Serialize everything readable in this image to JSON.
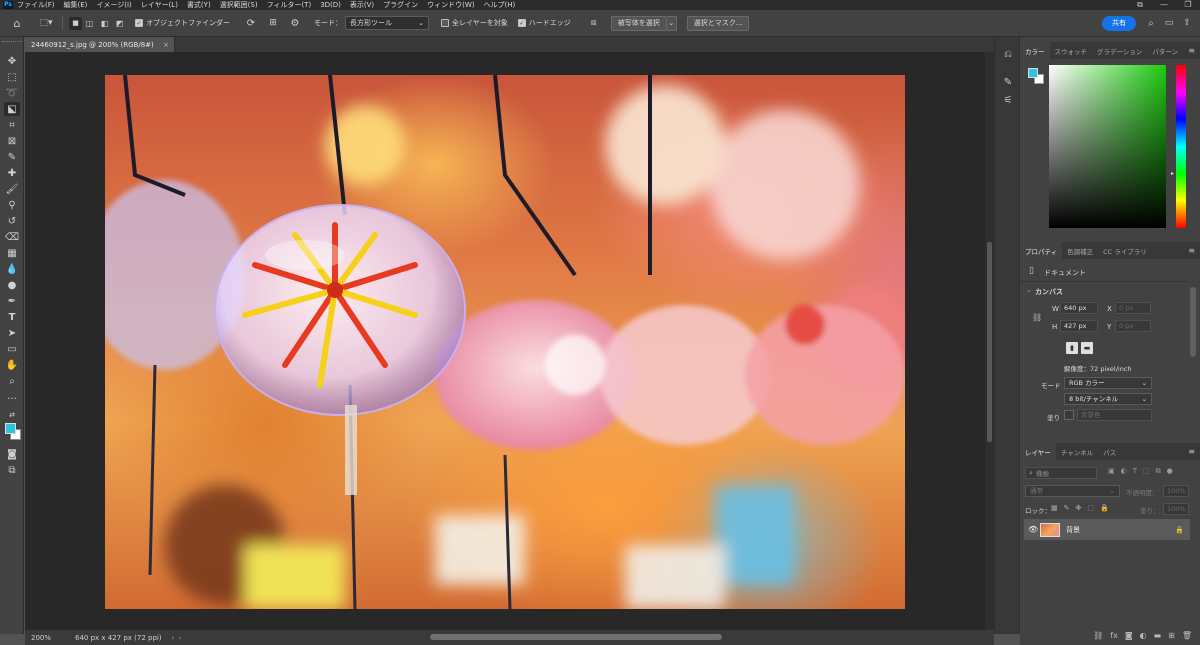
{
  "menubar": {
    "app_badge": "Ps",
    "items": [
      "ファイル(F)",
      "編集(E)",
      "イメージ(I)",
      "レイヤー(L)",
      "書式(Y)",
      "選択範囲(S)",
      "フィルター(T)",
      "3D(D)",
      "表示(V)",
      "プラグイン",
      "ウィンドウ(W)",
      "ヘルプ(H)"
    ],
    "window_controls": [
      "⧉",
      "—",
      "❐"
    ]
  },
  "options": {
    "object_finder_label": "オブジェクトファインダー",
    "mode_label": "モード：",
    "mode_value": "長方形ツール",
    "all_layers_label": "全レイヤーを対象",
    "hard_edge_label": "ハードエッジ",
    "select_subject_label": "被写体を選択",
    "select_mask_label": "選択とマスク...",
    "share_label": "共有"
  },
  "document": {
    "tab_title": "24460912_s.jpg @ 200% (RGB/8#)",
    "tab_close": "×",
    "zoom": "200%",
    "status_info": "640 px x 427 px (72 ppi)"
  },
  "color_panel": {
    "tabs": [
      "カラー",
      "スウォッチ",
      "グラデーション",
      "パターン"
    ],
    "foreground_color": "#2fc3de",
    "background_color": "#ffffff",
    "field_hue_color": "#1ecb10"
  },
  "properties_panel": {
    "tabs": [
      "プロパティ",
      "色調補正",
      "CC ライブラリ"
    ],
    "doc_label": "ドキュメント",
    "canvas_label": "カンバス",
    "w_label": "W",
    "w_value": "640 px",
    "h_label": "H",
    "h_value": "427 px",
    "x_label": "X",
    "x_value": "0 px",
    "y_label": "Y",
    "y_value": "0 px",
    "resolution": "解像度：72 pixel/inch",
    "mode_label": "モード",
    "mode_value": "RGB カラー",
    "depth_value": "8 bit/チャンネル",
    "fill_label": "塗り",
    "fill_value": "背景色"
  },
  "layers_panel": {
    "tabs": [
      "レイヤー",
      "チャンネル",
      "パス"
    ],
    "search_placeholder": "種類",
    "blend_mode": "通常",
    "opacity_label": "不透明度：",
    "opacity_value": "100%",
    "lock_label": "ロック：",
    "fill_label": "塗り：",
    "fill_value": "100%",
    "layer_name": "背景"
  }
}
